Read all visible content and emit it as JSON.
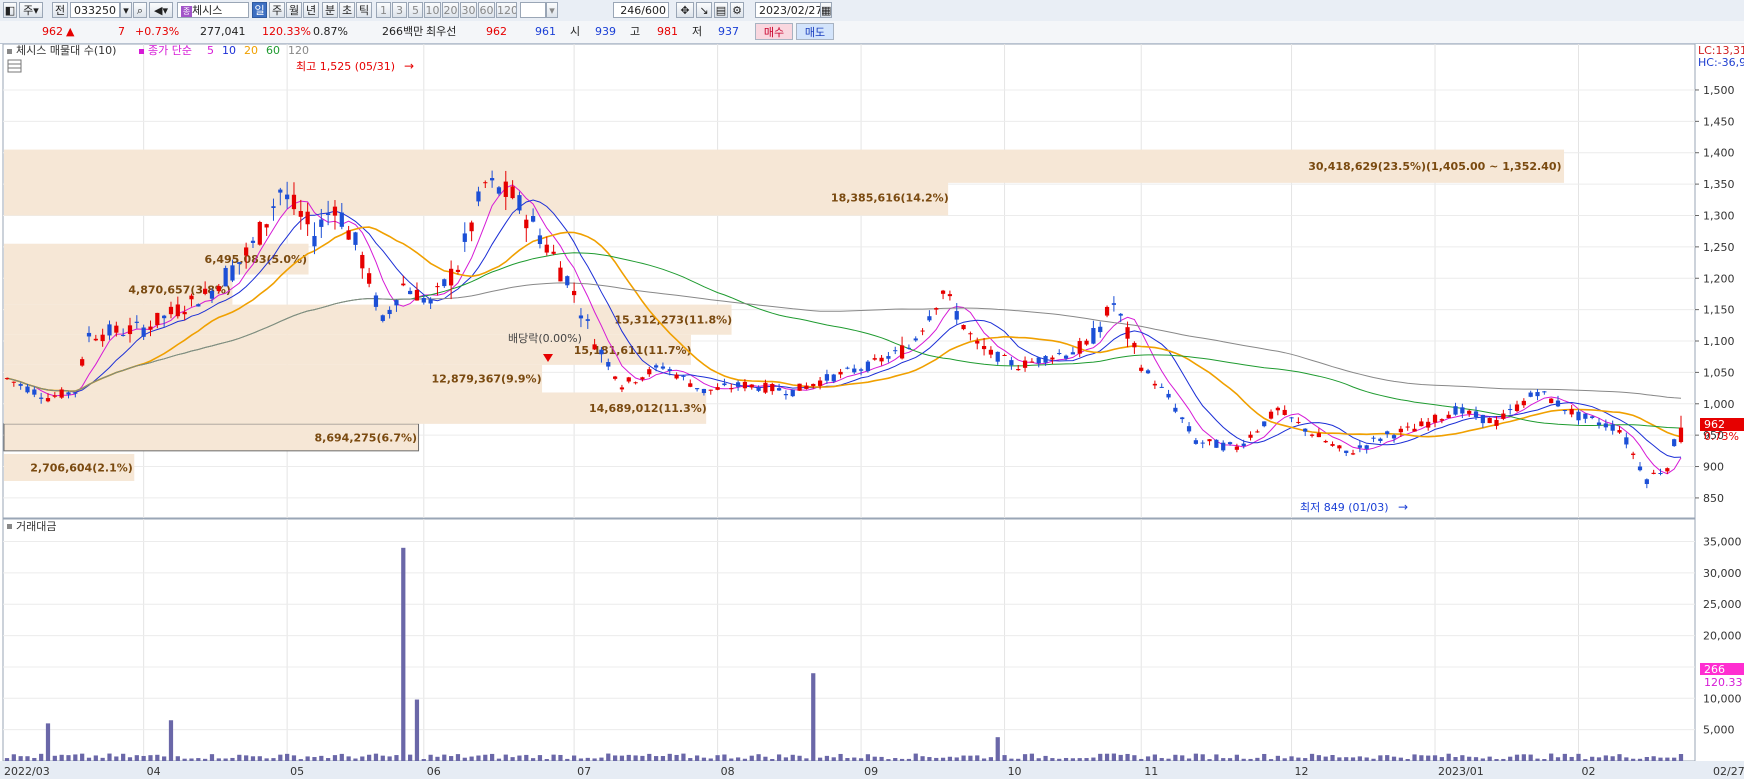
{
  "toolbar": {
    "market": "주",
    "jeon": "전",
    "code": "033250",
    "name": "체시스",
    "periods": [
      "일",
      "주",
      "월",
      "년",
      "분",
      "초",
      "틱"
    ],
    "minutes": [
      "1",
      "3",
      "5",
      "10",
      "20",
      "30",
      "60",
      "120"
    ],
    "count": "246",
    "count_total": "/600",
    "date": "2023/02/27"
  },
  "info": {
    "price": "962",
    "arrow": "▲",
    "change": "7",
    "change_pct": "+0.73%",
    "volume": "277,041",
    "vol_ratio": "120.33%",
    "turnover": "0.87%",
    "amount": "266백만",
    "best_label": "최우선",
    "best_ask": "962",
    "best_bid": "961",
    "open_label": "시",
    "open": "939",
    "high_label": "고",
    "high": "981",
    "low_label": "저",
    "low": "937",
    "buy_label": "매수",
    "sell_label": "매도"
  },
  "legend": {
    "vp_label": "체시스 매물대 수(10)",
    "ma_label": "종가 단순",
    "ma_periods": [
      "5",
      "10",
      "20",
      "60",
      "120"
    ],
    "ma_colors": [
      "#d61ad6",
      "#1c2fd6",
      "#f0a000",
      "#1f9b30",
      "#888888"
    ],
    "vol_label": "거래대금",
    "lc": "LC:13,31",
    "hc": "HC:-36,9"
  },
  "annotations": {
    "high_marker": "최고 1,525 (05/31)",
    "low_marker": "최저 849 (01/03)",
    "dividend": "배당락(0.00%)",
    "price_tag": "962",
    "pct_tag": "0.73%",
    "vol_tag": "266",
    "vol_tag2": "120.33"
  },
  "colors": {
    "up": "#e60000",
    "down": "#1c4fd6",
    "vp": "#f6e7d6",
    "vp_text": "#7a4a10",
    "volume": "#6a67a8"
  },
  "chart_data": {
    "type": "candlestick",
    "y_ticks": [
      850,
      900,
      950,
      1000,
      1050,
      1100,
      1150,
      1200,
      1250,
      1300,
      1350,
      1400,
      1450,
      1500
    ],
    "y_tick_labels": [
      "850",
      "900",
      "950",
      "1,000",
      "1,050",
      "1,100",
      "1,150",
      "1,200",
      "1,250",
      "1,300",
      "1,350",
      "1,400",
      "1,450",
      "1,500"
    ],
    "ylim": [
      818,
      1535
    ],
    "x_labels": [
      "2022/03",
      "04",
      "05",
      "06",
      "07",
      "08",
      "09",
      "10",
      "11",
      "12",
      "2023/01",
      "02",
      "02/27"
    ],
    "volume_ticks": [
      5000,
      10000,
      15000,
      20000,
      25000,
      30000,
      35000
    ],
    "volume_tick_labels": [
      "5,000",
      "10,000",
      "15,000",
      "20,000",
      "25,000",
      "30,000",
      "35,000"
    ],
    "volume_spikes": [
      {
        "date": "2022/03",
        "value": 6000
      },
      {
        "date": "2022/05",
        "value": 6500
      },
      {
        "date": "2022/05/31",
        "value": 34000
      },
      {
        "date": "2022/06",
        "value": 9800
      },
      {
        "date": "2022/08",
        "value": 14000
      },
      {
        "date": "2022/09",
        "value": 3800
      }
    ],
    "volume_profile": [
      {
        "label": "2,706,604(2.1%)",
        "price": [
          877,
          920
        ]
      },
      {
        "label": "8,694,275(6.7%)",
        "price": [
          925,
          968
        ]
      },
      {
        "label": "14,689,012(11.3%)",
        "price": [
          968,
          1018
        ]
      },
      {
        "label": "12,879,367(9.9%)",
        "price": [
          1018,
          1062
        ]
      },
      {
        "label": "15,181,611(11.7%)",
        "price": [
          1062,
          1110
        ]
      },
      {
        "label": "15,312,273(11.8%)",
        "price": [
          1110,
          1158
        ]
      },
      {
        "label": "4,870,657(3.8%)",
        "price": [
          1158,
          1206
        ]
      },
      {
        "label": "6,495,083(5.0%)",
        "price": [
          1206,
          1255
        ]
      },
      {
        "label": "18,385,616(14.2%)",
        "price": [
          1300,
          1357
        ]
      },
      {
        "label": "30,418,629(23.5%)(1,405.00 ~ 1,352.40)",
        "price": [
          1352,
          1405
        ]
      }
    ],
    "series": [
      {
        "name": "5",
        "values": []
      },
      {
        "name": "10",
        "values": []
      },
      {
        "name": "20",
        "values": []
      },
      {
        "name": "60",
        "values": []
      },
      {
        "name": "120",
        "values": []
      }
    ],
    "last": {
      "open": 939,
      "high": 981,
      "low": 937,
      "close": 962
    }
  }
}
